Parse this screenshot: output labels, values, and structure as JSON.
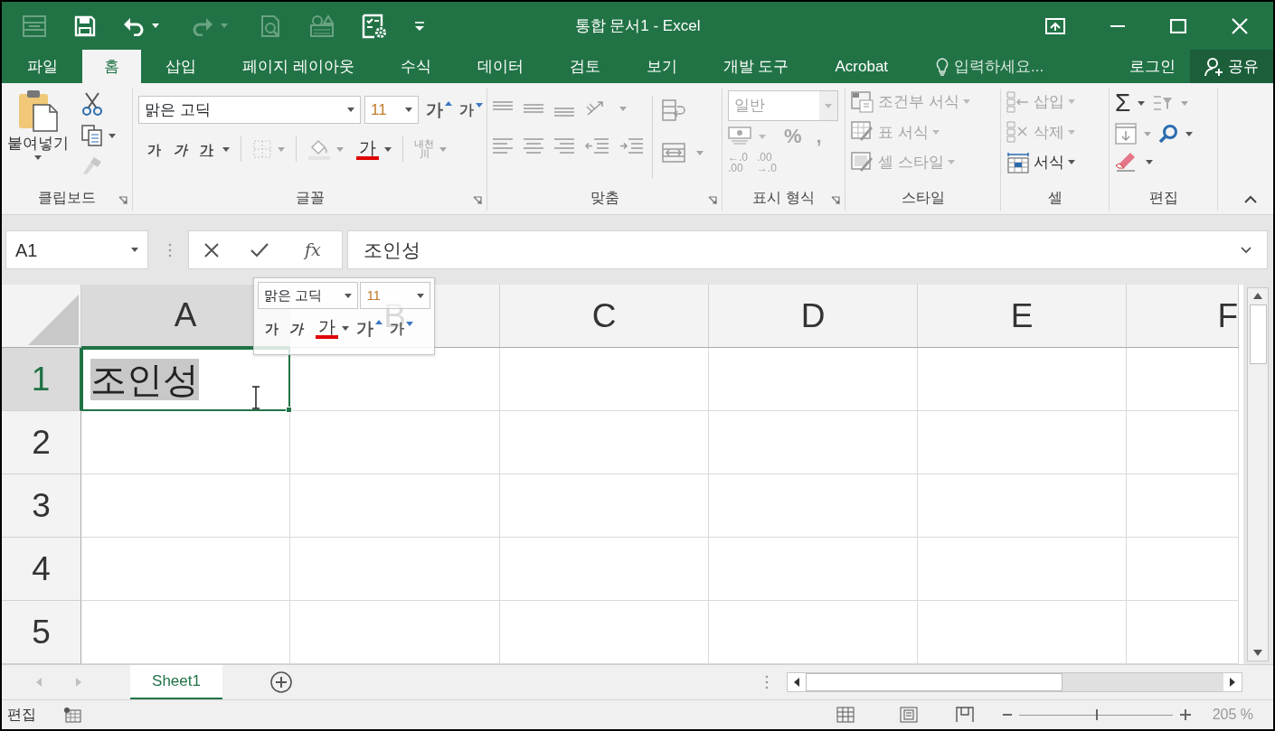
{
  "window": {
    "title": "통합 문서1 - Excel"
  },
  "quick_access": [
    {
      "kind": "form",
      "disabled": true
    },
    {
      "kind": "save",
      "disabled": false
    },
    {
      "kind": "undo",
      "disabled": false
    },
    {
      "kind": "redo",
      "disabled": true
    },
    {
      "kind": "preview",
      "disabled": true
    },
    {
      "kind": "shapes",
      "disabled": true
    },
    {
      "kind": "settings",
      "disabled": false
    },
    {
      "kind": "customize",
      "disabled": false
    }
  ],
  "tabs": [
    {
      "label": "파일",
      "selected": false
    },
    {
      "label": "홈",
      "selected": true
    },
    {
      "label": "삽입",
      "selected": false
    },
    {
      "label": "페이지 레이아웃",
      "selected": false
    },
    {
      "label": "수식",
      "selected": false
    },
    {
      "label": "데이터",
      "selected": false
    },
    {
      "label": "검토",
      "selected": false
    },
    {
      "label": "보기",
      "selected": false
    },
    {
      "label": "개발 도구",
      "selected": false
    },
    {
      "label": "Acrobat",
      "selected": false
    }
  ],
  "tell_me": {
    "placeholder": "입력하세요..."
  },
  "account": {
    "sign_in": "로그인",
    "share": "공유"
  },
  "ribbon": {
    "clipboard": {
      "label": "클립보드",
      "paste": "붙여넣기"
    },
    "font": {
      "label": "글꼴",
      "font_name": "맑은 고딕",
      "font_size": "11",
      "grow": "가",
      "shrink": "가",
      "bold": "가",
      "italic": "가",
      "underline": "가",
      "font_color": "가",
      "phonetic": [
        "내천",
        "川"
      ]
    },
    "alignment": {
      "label": "맞춤"
    },
    "number": {
      "label": "표시 형식",
      "format": "일반",
      "percent": "%",
      "comma": ",",
      "decrease_decimal": [
        "←.0",
        ".00"
      ],
      "increase_decimal": [
        ".00",
        "→.0"
      ],
      "disabled": true
    },
    "styles": {
      "label": "스타일",
      "items": [
        {
          "kind": "conditional",
          "label": "조건부 서식",
          "disabled": true
        },
        {
          "kind": "table",
          "label": "표 서식",
          "disabled": true
        },
        {
          "kind": "cell_style",
          "label": "셀 스타일",
          "disabled": true
        }
      ]
    },
    "cells": {
      "label": "셀",
      "items": [
        {
          "kind": "insert",
          "label": "삽입",
          "disabled": true
        },
        {
          "kind": "delete",
          "label": "삭제",
          "disabled": true
        },
        {
          "kind": "format",
          "label": "서식",
          "disabled": false
        }
      ]
    },
    "editing": {
      "label": "편집",
      "autosum": "Σ"
    }
  },
  "formula_bar": {
    "name_box": "A1",
    "function": "fx",
    "formula": "조인성"
  },
  "columns": [
    {
      "label": "A",
      "selected": true
    },
    {
      "label": "B",
      "selected": false
    },
    {
      "label": "C",
      "selected": false
    },
    {
      "label": "D",
      "selected": false
    },
    {
      "label": "E",
      "selected": false
    },
    {
      "label": "F",
      "selected": false
    }
  ],
  "rows": [
    {
      "label": "1",
      "selected": true
    },
    {
      "label": "2",
      "selected": false
    },
    {
      "label": "3",
      "selected": false
    },
    {
      "label": "4",
      "selected": false
    },
    {
      "label": "5",
      "selected": false
    }
  ],
  "active_cell": {
    "value": "조인성",
    "text_selected": true
  },
  "mini_toolbar": {
    "font_name": "맑은 고딕",
    "font_size": "11",
    "bold": "가",
    "italic": "가",
    "font_color": "가",
    "grow": "가",
    "shrink": "가"
  },
  "sheet_tabs": [
    {
      "label": "Sheet1",
      "selected": true
    }
  ],
  "status_bar": {
    "mode": "편집",
    "zoom": "205 %",
    "zoom_slider": {
      "level": 0.5
    }
  }
}
